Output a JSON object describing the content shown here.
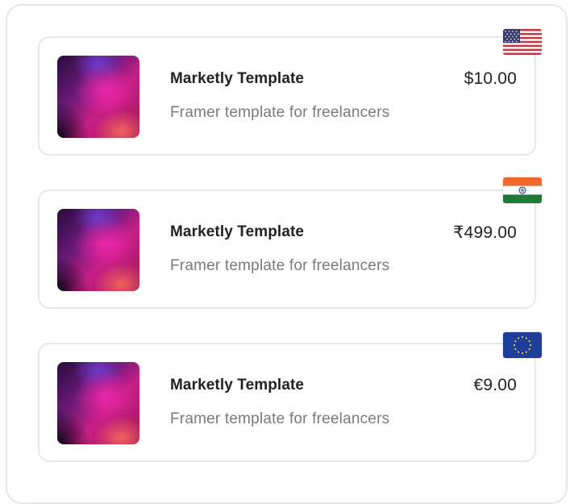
{
  "products": [
    {
      "title": "Marketly Template",
      "subtitle": "Framer template for freelancers",
      "price": "$10.00",
      "flag_icon": "us-flag-icon"
    },
    {
      "title": "Marketly Template",
      "subtitle": "Framer template for freelancers",
      "price": "₹499.00",
      "flag_icon": "india-flag-icon"
    },
    {
      "title": "Marketly Template",
      "subtitle": "Framer template for freelancers",
      "price": "€9.00",
      "flag_icon": "eu-flag-icon"
    }
  ],
  "colors": {
    "card_border": "#e7e7e7",
    "title": "#222222",
    "subtitle": "#7a7a7a"
  }
}
